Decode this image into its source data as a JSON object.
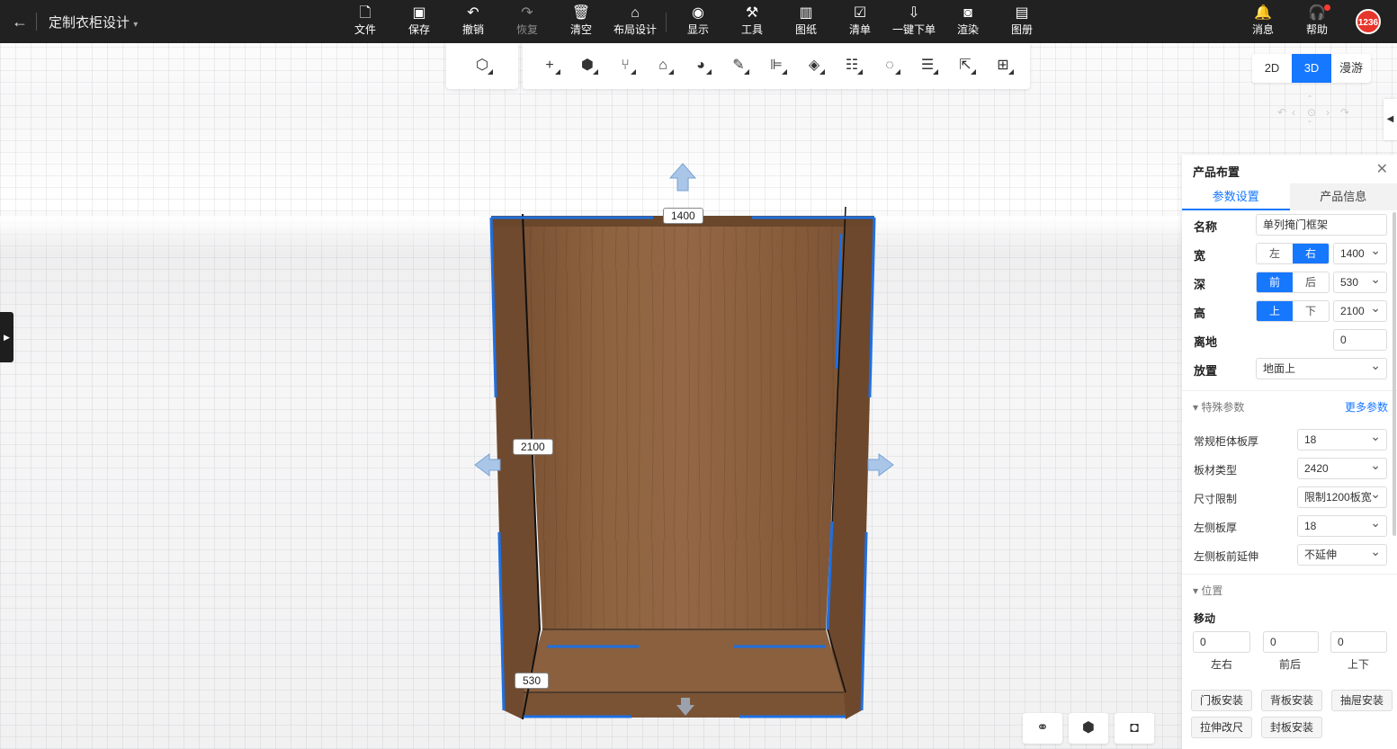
{
  "header": {
    "back_icon": "arrow-left-icon",
    "project_title": "定制衣柜设计",
    "menu": [
      {
        "label": "文件",
        "icon": "file-icon"
      },
      {
        "label": "保存",
        "icon": "save-icon"
      },
      {
        "label": "撤销",
        "icon": "undo-icon"
      },
      {
        "label": "恢复",
        "icon": "redo-icon"
      },
      {
        "label": "清空",
        "icon": "clear-icon"
      },
      {
        "label": "布局设计",
        "icon": "layout-icon"
      },
      {
        "label": "显示",
        "icon": "eye-icon"
      },
      {
        "label": "工具",
        "icon": "wrench-icon"
      },
      {
        "label": "图纸",
        "icon": "map-icon"
      },
      {
        "label": "清单",
        "icon": "checklist-icon"
      },
      {
        "label": "一键下单",
        "icon": "order-icon"
      },
      {
        "label": "渲染",
        "icon": "camera-icon"
      },
      {
        "label": "图册",
        "icon": "album-icon"
      }
    ],
    "right": [
      {
        "label": "消息",
        "icon": "bell-icon"
      },
      {
        "label": "帮助",
        "icon": "headset-icon"
      }
    ],
    "avatar_text": "1236"
  },
  "view_modes": [
    "2D",
    "3D",
    "漫游"
  ],
  "active_view": "3D",
  "dimensions": {
    "width": "1400",
    "height": "2100",
    "depth": "530"
  },
  "panel": {
    "title": "产品布置",
    "tabs": [
      "参数设置",
      "产品信息"
    ],
    "name_label": "名称",
    "name_value": "单列掩门框架",
    "width_label": "宽",
    "width_seg": [
      "左",
      "右"
    ],
    "width_value": "1400",
    "depth_label": "深",
    "depth_seg": [
      "前",
      "后"
    ],
    "depth_value": "530",
    "height_label": "高",
    "height_seg": [
      "上",
      "下"
    ],
    "height_value": "2100",
    "ground_label": "离地",
    "ground_value": "0",
    "place_label": "放置",
    "place_value": "地面上",
    "special_title": "特殊参数",
    "more_params": "更多参数",
    "params": [
      {
        "label": "常规柜体板厚",
        "value": "18"
      },
      {
        "label": "板材类型",
        "value": "2420"
      },
      {
        "label": "尺寸限制",
        "value": "限制1200板宽"
      },
      {
        "label": "左侧板厚",
        "value": "18"
      },
      {
        "label": "左侧板前延伸",
        "value": "不延伸"
      }
    ],
    "position_title": "位置",
    "move_label": "移动",
    "move": [
      {
        "value": "0",
        "label": "左右"
      },
      {
        "value": "0",
        "label": "前后"
      },
      {
        "value": "0",
        "label": "上下"
      }
    ],
    "buttons": [
      "门板安装",
      "背板安装",
      "抽屉安装",
      "拉伸改尺",
      "封板安装"
    ]
  }
}
